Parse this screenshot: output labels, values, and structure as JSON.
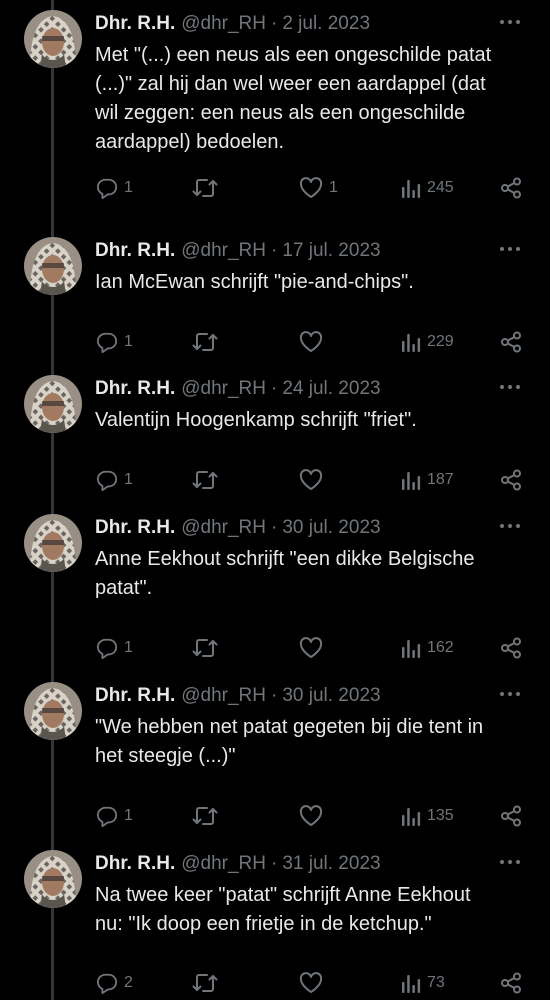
{
  "tweets": [
    {
      "name": "Dhr. R.H.",
      "handle": "@dhr_RH",
      "separator": "·",
      "date": "2 jul. 2023",
      "text": "Met \"(...) een neus als een ongeschilde patat\n(...)\" zal hij dan wel weer een aardappel (dat\nwil zeggen: een neus als een ongeschilde\naardappel) bedoelen.",
      "replies": "1",
      "retweets": "",
      "likes": "1",
      "views": "245"
    },
    {
      "name": "Dhr. R.H.",
      "handle": "@dhr_RH",
      "separator": "·",
      "date": "17 jul. 2023",
      "text": "Ian McEwan schrijft \"pie-and-chips\".",
      "replies": "1",
      "retweets": "",
      "likes": "",
      "views": "229"
    },
    {
      "name": "Dhr. R.H.",
      "handle": "@dhr_RH",
      "separator": "·",
      "date": "24 jul. 2023",
      "text": "Valentijn Hoogenkamp schrijft \"friet\".",
      "replies": "1",
      "retweets": "",
      "likes": "",
      "views": "187"
    },
    {
      "name": "Dhr. R.H.",
      "handle": "@dhr_RH",
      "separator": "·",
      "date": "30 jul. 2023",
      "text": "Anne Eekhout schrijft \"een dikke Belgische\npatat\".",
      "replies": "1",
      "retweets": "",
      "likes": "",
      "views": "162"
    },
    {
      "name": "Dhr. R.H.",
      "handle": "@dhr_RH",
      "separator": "·",
      "date": "30 jul. 2023",
      "text": "\"We hebben net patat gegeten bij die tent in\nhet steegje (...)\"",
      "replies": "1",
      "retweets": "",
      "likes": "",
      "views": "135"
    },
    {
      "name": "Dhr. R.H.",
      "handle": "@dhr_RH",
      "separator": "·",
      "date": "31 jul. 2023",
      "text": "Na twee keer \"patat\" schrijft Anne Eekhout\nnu: \"Ik doop een frietje in de ketchup.\"",
      "replies": "2",
      "retweets": "",
      "likes": "",
      "views": "73"
    }
  ],
  "icons": {
    "more": "more-horizontal-icon",
    "reply": "reply-bubble-icon",
    "retweet": "retweet-icon",
    "like": "heart-icon",
    "views": "bar-chart-icon",
    "share": "share-icon"
  },
  "colors": {
    "background": "#000000",
    "text": "#e7e9ea",
    "muted": "#71767b",
    "thread_line": "#333639"
  }
}
